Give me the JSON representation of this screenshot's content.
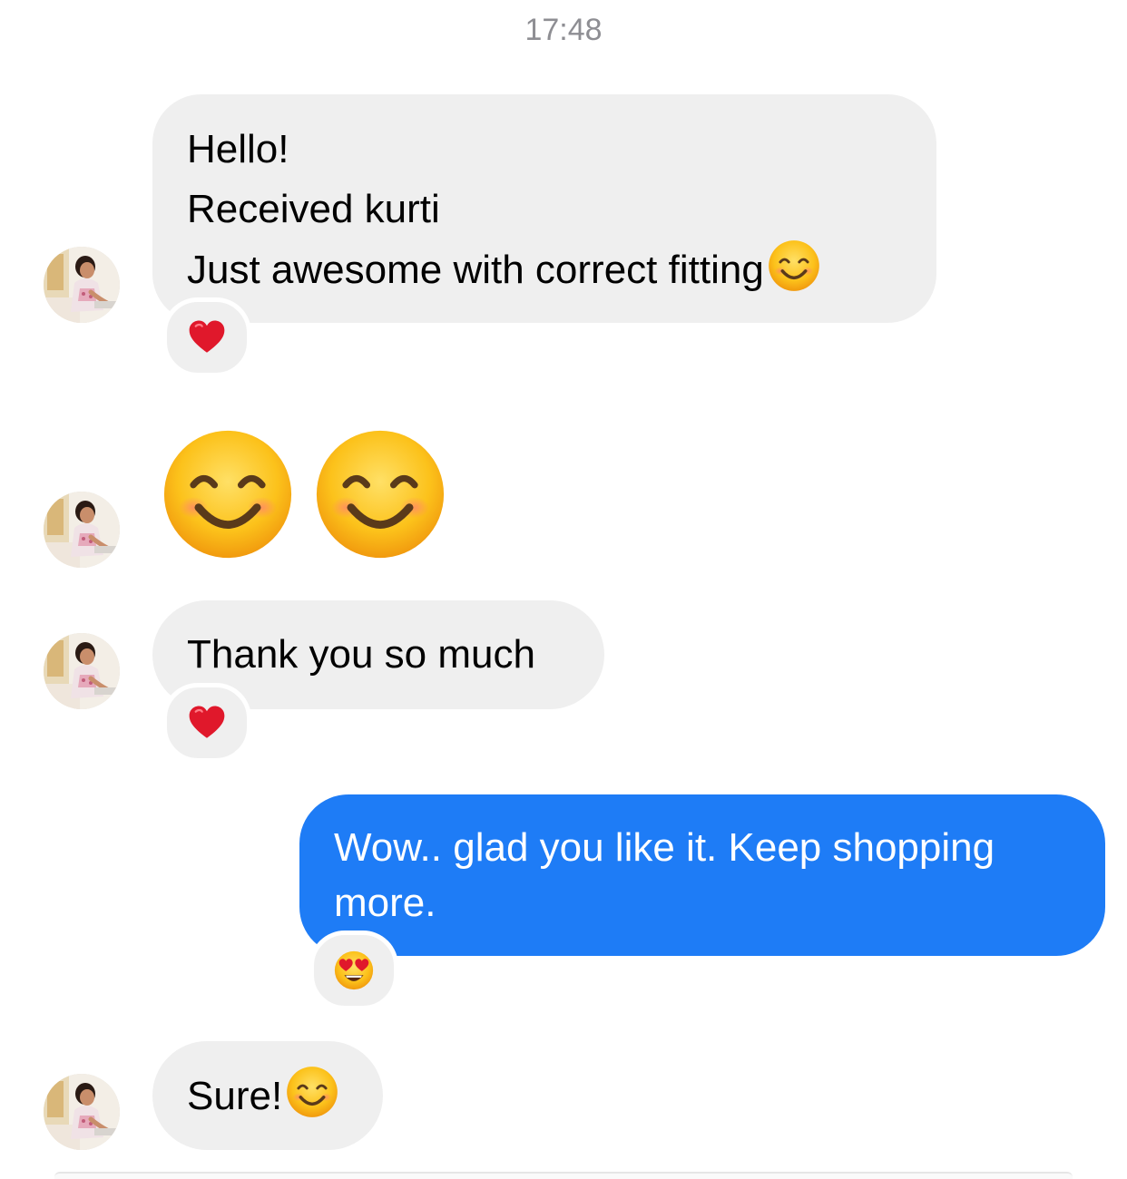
{
  "timestamp": "17:48",
  "messages": [
    {
      "direction": "incoming",
      "lines": [
        "Hello!",
        "Received kurti",
        "Just awesome with correct fitting"
      ],
      "trailing_emoji": "smiling-face-icon",
      "reaction": "heart-icon"
    },
    {
      "direction": "incoming",
      "emoji_only": [
        "smiling-face-icon",
        "smiling-face-icon"
      ]
    },
    {
      "direction": "incoming",
      "lines": [
        "Thank you so much"
      ],
      "reaction": "heart-icon"
    },
    {
      "direction": "outgoing",
      "lines": [
        "Wow.. glad you like it. Keep shopping",
        "more."
      ],
      "reaction": "heart-eyes-icon"
    },
    {
      "direction": "incoming",
      "lines": [
        "Sure!"
      ],
      "trailing_emoji": "smiling-face-icon"
    }
  ],
  "colors": {
    "incoming_bubble": "#efefef",
    "outgoing_bubble": "#1e7cf6",
    "timestamp_text": "#8e8e93"
  }
}
